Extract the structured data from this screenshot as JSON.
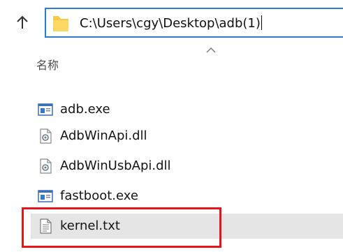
{
  "address": {
    "path": "C:\\Users\\cgy\\Desktop\\adb(1)"
  },
  "columns": {
    "name": "名称"
  },
  "files": [
    {
      "name": "adb.exe",
      "icon": "exe-app-icon"
    },
    {
      "name": "AdbWinApi.dll",
      "icon": "dll-file-icon"
    },
    {
      "name": "AdbWinUsbApi.dll",
      "icon": "dll-file-icon"
    },
    {
      "name": "fastboot.exe",
      "icon": "exe-app-icon"
    },
    {
      "name": "kernel.txt",
      "icon": "text-file-icon",
      "selected": true
    }
  ],
  "colors": {
    "address_border": "#2f7bd0",
    "selection": "#e5e5e5",
    "annotation": "#e8141b",
    "folder": "#f7c948"
  }
}
